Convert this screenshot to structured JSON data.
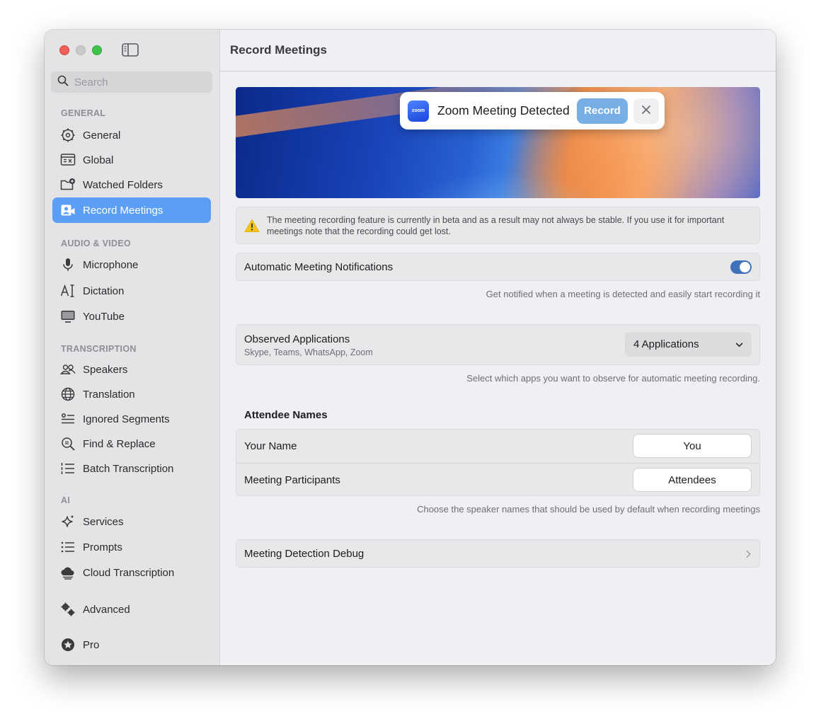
{
  "window": {
    "title": "Record Meetings"
  },
  "sidebar": {
    "search_placeholder": "Search",
    "sections": {
      "general": "GENERAL",
      "audio_video": "AUDIO & VIDEO",
      "transcription": "TRANSCRIPTION",
      "ai": "AI"
    },
    "items": {
      "general": "General",
      "global": "Global",
      "watched_folders": "Watched Folders",
      "record_meetings": "Record Meetings",
      "microphone": "Microphone",
      "dictation": "Dictation",
      "youtube": "YouTube",
      "speakers": "Speakers",
      "translation": "Translation",
      "ignored_segments": "Ignored Segments",
      "find_replace": "Find & Replace",
      "batch_transcription": "Batch Transcription",
      "services": "Services",
      "prompts": "Prompts",
      "cloud_transcription": "Cloud Transcription",
      "advanced": "Advanced",
      "pro": "Pro"
    },
    "active_item": "Record Meetings",
    "accent_color": "#5a9ff5"
  },
  "notification": {
    "app_logo_text": "zoom",
    "text": "Zoom Meeting Detected",
    "record_label": "Record"
  },
  "warning": {
    "text": "The meeting recording feature is currently in beta and as a result may not always be stable. If you use it for important meetings note that the recording could get lost."
  },
  "auto_notifications": {
    "label": "Automatic Meeting Notifications",
    "enabled": true,
    "hint": "Get notified when a meeting is detected and easily start recording it"
  },
  "observed_apps": {
    "label": "Observed Applications",
    "sublabel": "Skype, Teams, WhatsApp, Zoom",
    "selected": "4 Applications",
    "hint": "Select which apps you want to observe for automatic meeting recording."
  },
  "attendee_names": {
    "title": "Attendee Names",
    "your_name_label": "Your Name",
    "your_name_value": "You",
    "participants_label": "Meeting Participants",
    "participants_value": "Attendees",
    "hint": "Choose the speaker names that should be used by default when recording meetings"
  },
  "debug": {
    "label": "Meeting Detection Debug"
  }
}
